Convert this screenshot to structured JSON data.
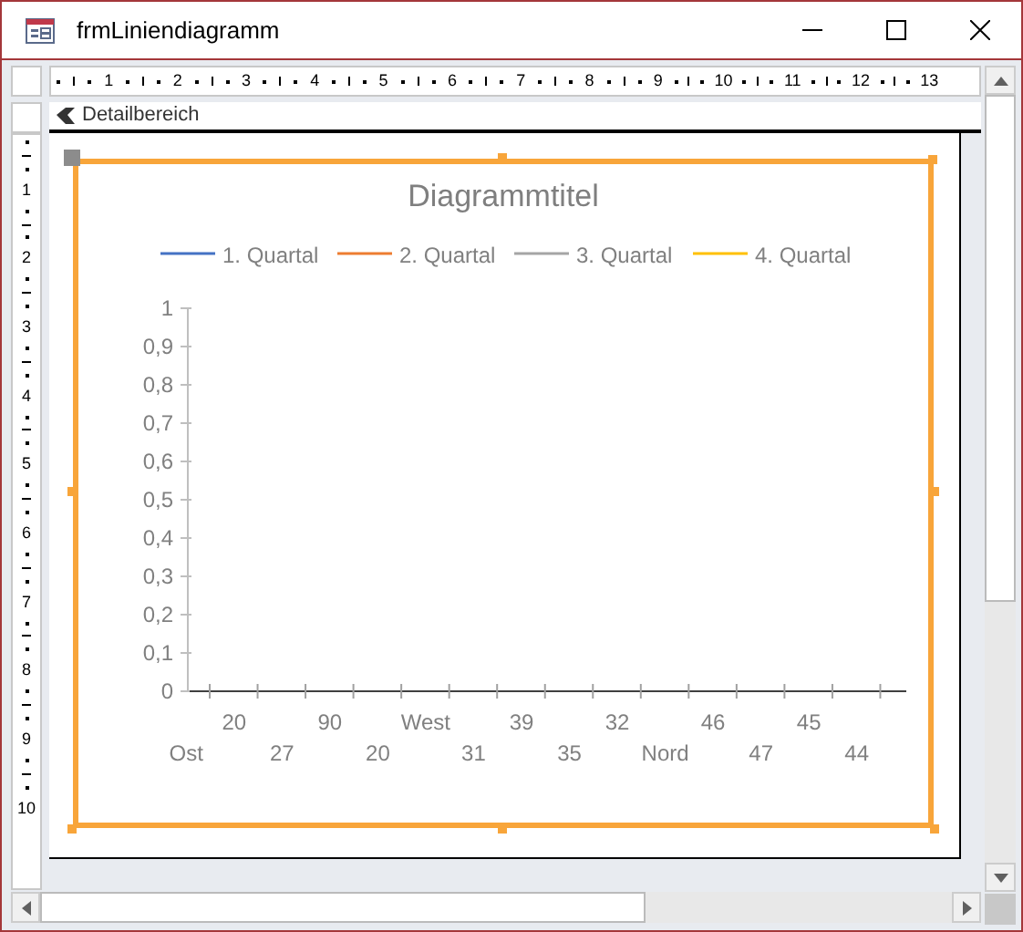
{
  "window": {
    "title": "frmLiniendiagramm"
  },
  "ruler": {
    "horizontal": [
      "1",
      "2",
      "3",
      "4",
      "5",
      "6",
      "7",
      "8",
      "9",
      "10",
      "11",
      "12",
      "13"
    ],
    "vertical": [
      "1",
      "2",
      "3",
      "4",
      "5",
      "6",
      "7",
      "8",
      "9",
      "10"
    ]
  },
  "section": {
    "label": "Detailbereich"
  },
  "chart": {
    "selected": true,
    "chart_data": {
      "type": "line",
      "title": "Diagrammtitel",
      "categories": [
        "Ost",
        "20",
        "27",
        "90",
        "20",
        "West",
        "31",
        "39",
        "35",
        "32",
        "Nord",
        "46",
        "47",
        "45",
        "44"
      ],
      "series": [
        {
          "name": "1. Quartal",
          "color": "#4472c4",
          "values": [
            null,
            null,
            null,
            null,
            null,
            null,
            null,
            null,
            null,
            null,
            null,
            null,
            null,
            null,
            null
          ]
        },
        {
          "name": "2. Quartal",
          "color": "#ed7d31",
          "values": [
            null,
            null,
            null,
            null,
            null,
            null,
            null,
            null,
            null,
            null,
            null,
            null,
            null,
            null,
            null
          ]
        },
        {
          "name": "3. Quartal",
          "color": "#a5a5a5",
          "values": [
            null,
            null,
            null,
            null,
            null,
            null,
            null,
            null,
            null,
            null,
            null,
            null,
            null,
            null,
            null
          ]
        },
        {
          "name": "4. Quartal",
          "color": "#ffc000",
          "values": [
            null,
            null,
            null,
            null,
            null,
            null,
            null,
            null,
            null,
            null,
            null,
            null,
            null,
            null,
            null
          ]
        }
      ],
      "ylim": [
        0,
        1
      ],
      "yticks": [
        {
          "value": 0,
          "label": "0"
        },
        {
          "value": 0.1,
          "label": "0,1"
        },
        {
          "value": 0.2,
          "label": "0,2"
        },
        {
          "value": 0.3,
          "label": "0,3"
        },
        {
          "value": 0.4,
          "label": "0,4"
        },
        {
          "value": 0.5,
          "label": "0,5"
        },
        {
          "value": 0.6,
          "label": "0,6"
        },
        {
          "value": 0.7,
          "label": "0,7"
        },
        {
          "value": 0.8,
          "label": "0,8"
        },
        {
          "value": 0.9,
          "label": "0,9"
        },
        {
          "value": 1,
          "label": "1"
        }
      ]
    }
  }
}
